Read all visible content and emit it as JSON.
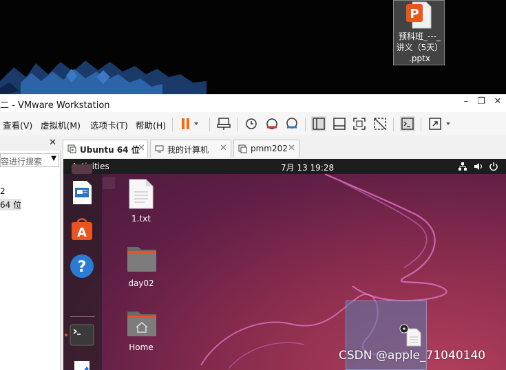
{
  "host_desktop": {
    "file_icon": {
      "name": "预科班_---_讲义（5天）.pptx",
      "line1": "预科班_---_",
      "line2": "讲义（5天）",
      "line3": ".pptx"
    }
  },
  "vmware": {
    "title": "二 - VMware Workstation",
    "window_controls": {
      "minimize": "–",
      "restore": "❐",
      "close": "✕"
    },
    "menu": [
      "查看(V)",
      "虚拟机(M)",
      "选项卡(T)",
      "帮助(H)"
    ],
    "library": {
      "close": "✕",
      "search_placeholder": "容进行搜索",
      "items": [
        "2",
        "64 位"
      ]
    },
    "tabs": [
      {
        "label": "Ubuntu 64 位",
        "active": true,
        "close": "✕"
      },
      {
        "label": "我的计算机",
        "active": false,
        "close": "✕"
      },
      {
        "label": "pmm202",
        "active": false,
        "close": "✕"
      }
    ]
  },
  "guest": {
    "activities": "Activities",
    "clock": "7月 13  19:28",
    "desktop_items": [
      {
        "label": "1.txt",
        "icon": "text-file-icon"
      },
      {
        "label": "day02",
        "icon": "folder-icon"
      },
      {
        "label": "Home",
        "icon": "home-folder-icon"
      }
    ],
    "dock": [
      "libreoffice-impress-icon",
      "ubuntu-software-icon",
      "help-icon",
      "terminal-icon",
      "text-editor-icon"
    ]
  },
  "watermark": "CSDN @apple_71040140",
  "colors": {
    "ubuntu_orange": "#e95420",
    "vmware_pause": "#ff6a00",
    "guest_bg": "#6b2449"
  }
}
